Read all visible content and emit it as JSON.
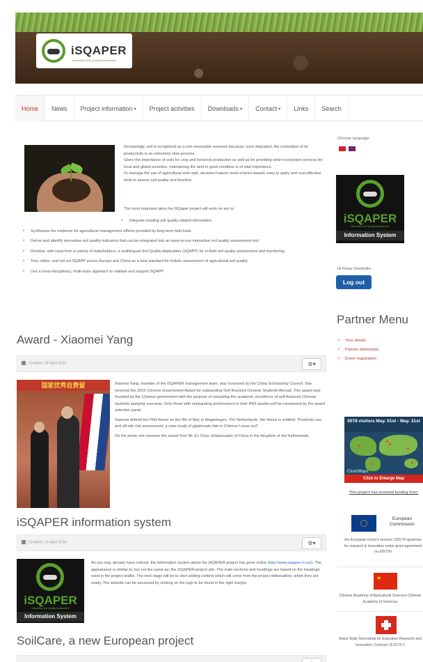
{
  "header": {
    "logo_text": "iSQAPER",
    "logo_tagline": "Interactive Soil Quality Assessment"
  },
  "nav": {
    "items": [
      {
        "label": "Home",
        "dropdown": false
      },
      {
        "label": "News",
        "dropdown": false
      },
      {
        "label": "Project information",
        "dropdown": true
      },
      {
        "label": "Project activities",
        "dropdown": false
      },
      {
        "label": "Downloads",
        "dropdown": true
      },
      {
        "label": "Contact",
        "dropdown": true
      },
      {
        "label": "Links",
        "dropdown": false
      },
      {
        "label": "Search",
        "dropdown": false
      }
    ]
  },
  "intro": {
    "paragraphs": [
      "Increasingly, soil is recognized as a non-renewable resource because, once degraded, the restoration of its productivity is an extremely slow process.",
      "Given the importance of soils for crop and livestock production as well as for providing wider ecosystem services for local and global societies, maintaining the land in good condition is of vital importance.",
      "To manage the use of agricultural soils well, decision-makers need science-based, easy to apply and cost-effective tools to assess soil quality and function."
    ],
    "aims_lead": "The most important aims the iSQaper project will work on are to:",
    "aims": [
      "Integrate existing soil quality related information",
      "Synthesize the evidence for agricultural management effects provided by long-term field trials",
      "Derive and identify innovative soil quality indicators that can be integrated into an easy-to-use interactive soil quality assessment tool",
      "Develop, with input from a variety of stakeholders, a multilingual Soil Quality Application (SQAPP) for in-field soil quality assessment and monitoring",
      "Test, refine, and roll out SQAPP across Europe and China as a new standard for holistic assessment of agricultural soil quality",
      "Use a trans-disciplinary, multi-actor approach to validate and support SQAPP"
    ]
  },
  "articles": [
    {
      "title": "Award - Xiaomei Yang",
      "created": "Created: 18 April 2016",
      "photo_sign": "国家优秀自费留",
      "paragraphs": [
        "Xiaomei Yang, member of the iSQAPER management team, was honoured by the China Scholarship Council. She received the 2015 Chinese Government Award for outstanding Self-financed Chinese Students Abroad. This award was founded by the Chinese government with the purpose of rewarding the academic excellence of self-financed Chinese students studying overseas. Only those with outstanding performance in their PhD studies will be considered by the award selection panel.",
        "Xiaomei defend her PhD-thesis on the 9th of May in Wageningen, The Netherlands. Her thesis is entitled: \"Pesticide use and off-site risk assessment: a case study of glyphosate fate in Chinese Loess soil\"",
        "On the photo she receives the award from Mr Xu Chen, Embassador of China in the Kingdom of the Netherlands."
      ]
    },
    {
      "title": "iSQAPER information system",
      "created": "Created: 12 April 2016",
      "paragraph_before_link": "As you may already have noticed, the information system about the iSQAPER project has gone online (",
      "link": "http://www.isqaper-is.eu/",
      "paragraph_after_link": "). The appearance is similar to, but not the same as, the iSQAPER-project site. The main sections and headings are based on the headings used in the project leaflet. The next stage will be to start adding content which will come from the project deliverables, when they are ready. The website can be accessed by clicking on the logo to be found in the right margin."
    },
    {
      "title": "SoilCare, a new European project"
    }
  ],
  "isq_logo": {
    "big": "iSQAPER",
    "tag": "Interactive Soil Quality Assessment",
    "bar": "Information System"
  },
  "sidebar": {
    "choose_language": "Choose language",
    "greeting": "Hi Klaas Oostindie,",
    "logout": "Log out",
    "partner_menu_title": "Partner Menu",
    "partner_items": [
      "Your details",
      "Partner downloads",
      "Event registration"
    ],
    "map_header": "5078 visitors May. 01st - May. 31st",
    "map_brand": "ClustrMaps",
    "map_button": "Click to Enlarge Map",
    "funding_title": "This project has received funding from:",
    "eu_label": "European Commission",
    "eu_text": "the European Union's Horizon 2020 Programme for research & innovation under grant agreement no 635750",
    "cn_text": "Chinese Academy of Agricultural Sciences Chinese Academy of Sciences",
    "ch_text": "Swiss State Secretariat for Education Research and Innovation. Contract 15.0170-1"
  },
  "colors": {
    "nav_active": "#c0392b",
    "logout_button": "#1f5fa8",
    "partner_link": "#b5392b",
    "logo_green": "#5aa02c"
  }
}
